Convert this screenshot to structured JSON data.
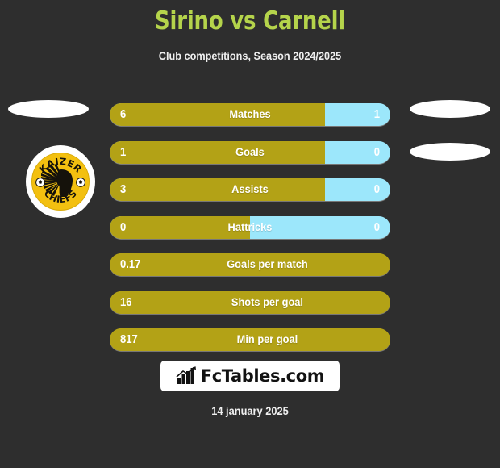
{
  "header": {
    "title": "Sirino vs Carnell",
    "subtitle": "Club competitions, Season 2024/2025",
    "title_color": "#b5d44b"
  },
  "theme": {
    "background": "#2e2e2e",
    "home_color": "#b3a216",
    "away_color": "#9ce7fb",
    "text_color": "#ffffff"
  },
  "home_club": {
    "name": "KAIZER CHIEFS",
    "badge_top_text": "KAIZER",
    "badge_bottom_text": "CHIEFS",
    "badge_bg": "#f3c010"
  },
  "stats": [
    {
      "label": "Matches",
      "home": "6",
      "away": "1",
      "home_pct": 76.7,
      "has_away": true
    },
    {
      "label": "Goals",
      "home": "1",
      "away": "0",
      "home_pct": 76.7,
      "has_away": true
    },
    {
      "label": "Assists",
      "home": "3",
      "away": "0",
      "home_pct": 76.7,
      "has_away": true
    },
    {
      "label": "Hattricks",
      "home": "0",
      "away": "0",
      "home_pct": 50.0,
      "has_away": true
    },
    {
      "label": "Goals per match",
      "home": "0.17",
      "away": "",
      "home_pct": 100,
      "has_away": false
    },
    {
      "label": "Shots per goal",
      "home": "16",
      "away": "",
      "home_pct": 100,
      "has_away": false
    },
    {
      "label": "Min per goal",
      "home": "817",
      "away": "",
      "home_pct": 100,
      "has_away": false
    }
  ],
  "footer": {
    "brand": "FcTables.com",
    "brand_icon": "bar-chart-trending-up-icon",
    "date": "14 january 2025"
  }
}
